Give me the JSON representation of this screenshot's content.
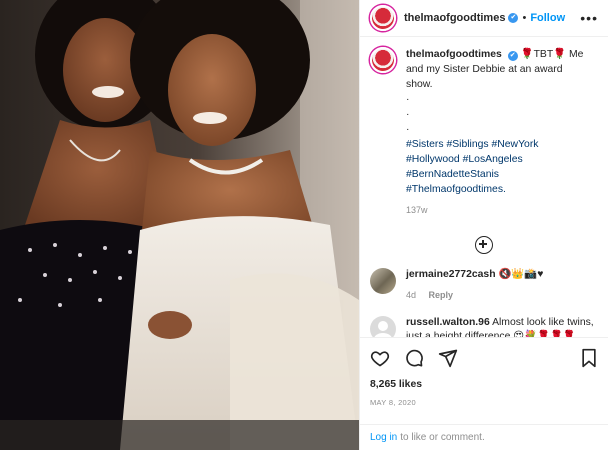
{
  "header": {
    "username": "thelmaofgoodtimes",
    "verified_mark": "✔",
    "separator": "•",
    "follow_label": "Follow",
    "more_label": "•••"
  },
  "caption": {
    "username": "thelmaofgoodtimes",
    "text": "🌹TBT🌹 Me and my Sister Debbie at an award show.",
    "dots": [
      "·",
      "·",
      "·"
    ],
    "hashtags": [
      "#Sisters",
      "#Siblings",
      "#NewYork",
      "#Hollywood",
      "#LosAngeles",
      "#BernNadetteStanis",
      "#Thelmaofgoodtimes."
    ],
    "age": "137w"
  },
  "comments": [
    {
      "username": "jermaine2772cash",
      "text": "🔇👑📸♥",
      "age": "4d",
      "reply_label": "Reply"
    },
    {
      "username": "russell.walton.96",
      "text": "Almost look like twins, just a height difference 😍💐🌹🌹🌹",
      "age": "",
      "reply_label": ""
    }
  ],
  "likes": "8,265 likes",
  "date": "MAY 8, 2020",
  "login_bar": {
    "login_label": "Log in",
    "rest": "to like or comment."
  },
  "icons": [
    "avatar",
    "verified-icon",
    "more-icon",
    "add-comment-icon",
    "heart-icon",
    "comment-icon",
    "share-icon",
    "bookmark-icon"
  ],
  "colors": {
    "link_blue": "#0095f6",
    "hashtag_blue": "#00376b",
    "muted": "#8e8e8e",
    "text": "#262626"
  }
}
